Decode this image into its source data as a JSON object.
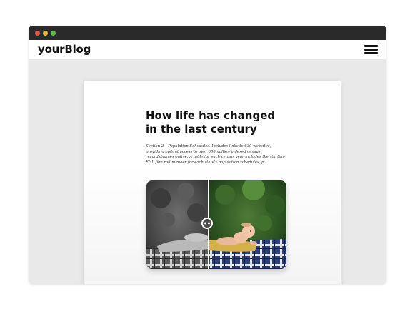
{
  "window": {
    "controls": [
      "close",
      "minimize",
      "maximize"
    ],
    "colors": {
      "close": "#e0584e",
      "minimize": "#e2b53c",
      "maximize": "#5fbf4e",
      "titlebar": "#2a2a2a",
      "background": "#e9e9e9"
    }
  },
  "navbar": {
    "brand": "yourBlog",
    "menu_icon": "hamburger-menu-icon"
  },
  "post": {
    "title": "How life has changed in the last century",
    "excerpt": "Section 2 – Population Schedules. Includes links to 630 websites, providing instant access to over 600 million indexed census records/names online. A table for each census year includes the starting FHL film roll number for each state's population schedules, p.",
    "image": {
      "kind": "before-after comparison slider",
      "left_side": "black-and-white photo",
      "right_side": "colorized photo",
      "handle_icon": "slider-handle-icon"
    }
  }
}
